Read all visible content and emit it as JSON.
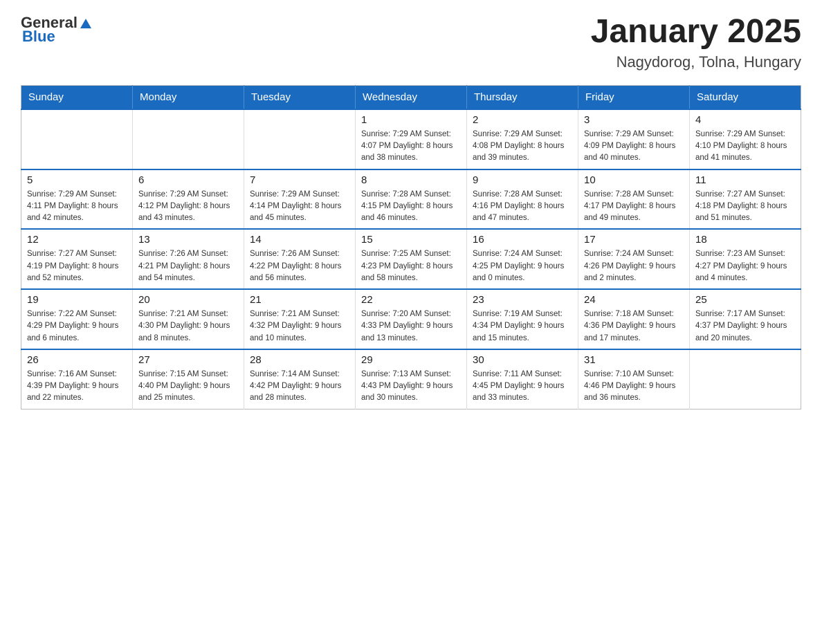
{
  "header": {
    "logo": {
      "general": "General",
      "blue": "Blue"
    },
    "title": "January 2025",
    "subtitle": "Nagydorog, Tolna, Hungary"
  },
  "weekdays": [
    "Sunday",
    "Monday",
    "Tuesday",
    "Wednesday",
    "Thursday",
    "Friday",
    "Saturday"
  ],
  "weeks": [
    [
      {
        "day": "",
        "info": ""
      },
      {
        "day": "",
        "info": ""
      },
      {
        "day": "",
        "info": ""
      },
      {
        "day": "1",
        "info": "Sunrise: 7:29 AM\nSunset: 4:07 PM\nDaylight: 8 hours\nand 38 minutes."
      },
      {
        "day": "2",
        "info": "Sunrise: 7:29 AM\nSunset: 4:08 PM\nDaylight: 8 hours\nand 39 minutes."
      },
      {
        "day": "3",
        "info": "Sunrise: 7:29 AM\nSunset: 4:09 PM\nDaylight: 8 hours\nand 40 minutes."
      },
      {
        "day": "4",
        "info": "Sunrise: 7:29 AM\nSunset: 4:10 PM\nDaylight: 8 hours\nand 41 minutes."
      }
    ],
    [
      {
        "day": "5",
        "info": "Sunrise: 7:29 AM\nSunset: 4:11 PM\nDaylight: 8 hours\nand 42 minutes."
      },
      {
        "day": "6",
        "info": "Sunrise: 7:29 AM\nSunset: 4:12 PM\nDaylight: 8 hours\nand 43 minutes."
      },
      {
        "day": "7",
        "info": "Sunrise: 7:29 AM\nSunset: 4:14 PM\nDaylight: 8 hours\nand 45 minutes."
      },
      {
        "day": "8",
        "info": "Sunrise: 7:28 AM\nSunset: 4:15 PM\nDaylight: 8 hours\nand 46 minutes."
      },
      {
        "day": "9",
        "info": "Sunrise: 7:28 AM\nSunset: 4:16 PM\nDaylight: 8 hours\nand 47 minutes."
      },
      {
        "day": "10",
        "info": "Sunrise: 7:28 AM\nSunset: 4:17 PM\nDaylight: 8 hours\nand 49 minutes."
      },
      {
        "day": "11",
        "info": "Sunrise: 7:27 AM\nSunset: 4:18 PM\nDaylight: 8 hours\nand 51 minutes."
      }
    ],
    [
      {
        "day": "12",
        "info": "Sunrise: 7:27 AM\nSunset: 4:19 PM\nDaylight: 8 hours\nand 52 minutes."
      },
      {
        "day": "13",
        "info": "Sunrise: 7:26 AM\nSunset: 4:21 PM\nDaylight: 8 hours\nand 54 minutes."
      },
      {
        "day": "14",
        "info": "Sunrise: 7:26 AM\nSunset: 4:22 PM\nDaylight: 8 hours\nand 56 minutes."
      },
      {
        "day": "15",
        "info": "Sunrise: 7:25 AM\nSunset: 4:23 PM\nDaylight: 8 hours\nand 58 minutes."
      },
      {
        "day": "16",
        "info": "Sunrise: 7:24 AM\nSunset: 4:25 PM\nDaylight: 9 hours\nand 0 minutes."
      },
      {
        "day": "17",
        "info": "Sunrise: 7:24 AM\nSunset: 4:26 PM\nDaylight: 9 hours\nand 2 minutes."
      },
      {
        "day": "18",
        "info": "Sunrise: 7:23 AM\nSunset: 4:27 PM\nDaylight: 9 hours\nand 4 minutes."
      }
    ],
    [
      {
        "day": "19",
        "info": "Sunrise: 7:22 AM\nSunset: 4:29 PM\nDaylight: 9 hours\nand 6 minutes."
      },
      {
        "day": "20",
        "info": "Sunrise: 7:21 AM\nSunset: 4:30 PM\nDaylight: 9 hours\nand 8 minutes."
      },
      {
        "day": "21",
        "info": "Sunrise: 7:21 AM\nSunset: 4:32 PM\nDaylight: 9 hours\nand 10 minutes."
      },
      {
        "day": "22",
        "info": "Sunrise: 7:20 AM\nSunset: 4:33 PM\nDaylight: 9 hours\nand 13 minutes."
      },
      {
        "day": "23",
        "info": "Sunrise: 7:19 AM\nSunset: 4:34 PM\nDaylight: 9 hours\nand 15 minutes."
      },
      {
        "day": "24",
        "info": "Sunrise: 7:18 AM\nSunset: 4:36 PM\nDaylight: 9 hours\nand 17 minutes."
      },
      {
        "day": "25",
        "info": "Sunrise: 7:17 AM\nSunset: 4:37 PM\nDaylight: 9 hours\nand 20 minutes."
      }
    ],
    [
      {
        "day": "26",
        "info": "Sunrise: 7:16 AM\nSunset: 4:39 PM\nDaylight: 9 hours\nand 22 minutes."
      },
      {
        "day": "27",
        "info": "Sunrise: 7:15 AM\nSunset: 4:40 PM\nDaylight: 9 hours\nand 25 minutes."
      },
      {
        "day": "28",
        "info": "Sunrise: 7:14 AM\nSunset: 4:42 PM\nDaylight: 9 hours\nand 28 minutes."
      },
      {
        "day": "29",
        "info": "Sunrise: 7:13 AM\nSunset: 4:43 PM\nDaylight: 9 hours\nand 30 minutes."
      },
      {
        "day": "30",
        "info": "Sunrise: 7:11 AM\nSunset: 4:45 PM\nDaylight: 9 hours\nand 33 minutes."
      },
      {
        "day": "31",
        "info": "Sunrise: 7:10 AM\nSunset: 4:46 PM\nDaylight: 9 hours\nand 36 minutes."
      },
      {
        "day": "",
        "info": ""
      }
    ]
  ]
}
